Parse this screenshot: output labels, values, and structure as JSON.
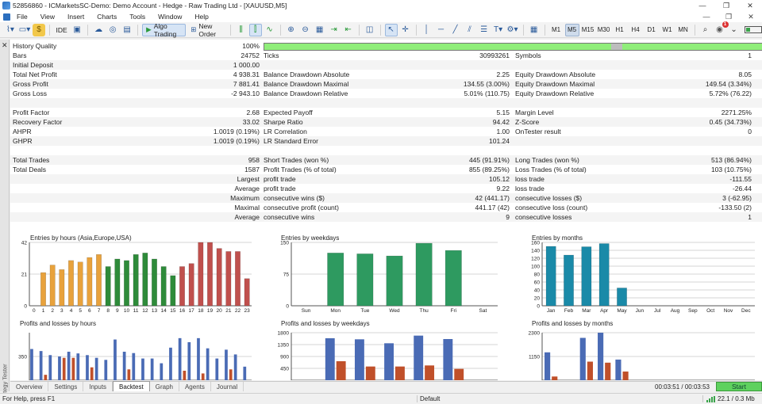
{
  "window": {
    "title": "52856860 - ICMarketsSC-Demo: Demo Account - Hedge - Raw Trading Ltd - [XAUUSD,M5]"
  },
  "menu": [
    "File",
    "View",
    "Insert",
    "Charts",
    "Tools",
    "Window",
    "Help"
  ],
  "toolbar": {
    "ide_label": "IDE",
    "algo_label": "Algo Trading",
    "neworder_label": "New Order",
    "timeframes": [
      "M1",
      "M5",
      "M15",
      "M30",
      "H1",
      "H4",
      "D1",
      "W1",
      "MN"
    ],
    "active_timeframe": "M5",
    "notifications": "1"
  },
  "side_panel": {
    "label": "Strategy Tester"
  },
  "report": {
    "history_quality": {
      "label": "History Quality",
      "value": "100%"
    },
    "rows": [
      {
        "l1": "Bars",
        "v1": "24752",
        "l2": "Ticks",
        "v2": "30993261",
        "l3": "Symbols",
        "v3": "1",
        "alt": false
      },
      {
        "l1": "Initial Deposit",
        "v1": "1 000.00",
        "l2": "",
        "v2": "",
        "l3": "",
        "v3": "",
        "alt": true
      },
      {
        "l1": "Total Net Profit",
        "v1": "4 938.31",
        "l2": "Balance Drawdown Absolute",
        "v2": "2.25",
        "l3": "Equity Drawdown Absolute",
        "v3": "8.05",
        "alt": false
      },
      {
        "l1": "Gross Profit",
        "v1": "7 881.41",
        "l2": "Balance Drawdown Maximal",
        "v2": "134.55 (3.00%)",
        "l3": "Equity Drawdown Maximal",
        "v3": "149.54 (3.34%)",
        "alt": true
      },
      {
        "l1": "Gross Loss",
        "v1": "-2 943.10",
        "l2": "Balance Drawdown Relative",
        "v2": "5.01% (110.75)",
        "l3": "Equity Drawdown Relative",
        "v3": "5.72% (76.22)",
        "alt": false
      },
      {
        "l1": "",
        "v1": "",
        "l2": "",
        "v2": "",
        "l3": "",
        "v3": "",
        "alt": true
      },
      {
        "l1": "Profit Factor",
        "v1": "2.68",
        "l2": "Expected Payoff",
        "v2": "5.15",
        "l3": "Margin Level",
        "v3": "2271.25%",
        "alt": false
      },
      {
        "l1": "Recovery Factor",
        "v1": "33.02",
        "l2": "Sharpe Ratio",
        "v2": "94.42",
        "l3": "Z-Score",
        "v3": "0.45 (34.73%)",
        "alt": true
      },
      {
        "l1": "AHPR",
        "v1": "1.0019 (0.19%)",
        "l2": "LR Correlation",
        "v2": "1.00",
        "l3": "OnTester result",
        "v3": "0",
        "alt": false
      },
      {
        "l1": "GHPR",
        "v1": "1.0019 (0.19%)",
        "l2": "LR Standard Error",
        "v2": "101.24",
        "l3": "",
        "v3": "",
        "alt": true
      },
      {
        "l1": "",
        "v1": "",
        "l2": "",
        "v2": "",
        "l3": "",
        "v3": "",
        "alt": false
      },
      {
        "l1": "Total Trades",
        "v1": "958",
        "l2": "Short Trades (won %)",
        "v2": "445 (91.91%)",
        "l3": "Long Trades (won %)",
        "v3": "513 (86.94%)",
        "alt": true
      },
      {
        "l1": "Total Deals",
        "v1": "1587",
        "l2": "Profit Trades (% of total)",
        "v2": "855 (89.25%)",
        "l3": "Loss Trades (% of total)",
        "v3": "103 (10.75%)",
        "alt": false
      },
      {
        "l1": "",
        "v1": "Largest",
        "l2": "profit trade",
        "v2": "105.12",
        "l3": "loss trade",
        "v3": "-111.55",
        "alt": true
      },
      {
        "l1": "",
        "v1": "Average",
        "l2": "profit trade",
        "v2": "9.22",
        "l3": "loss trade",
        "v3": "-26.44",
        "alt": false
      },
      {
        "l1": "",
        "v1": "Maximum",
        "l2": "consecutive wins ($)",
        "v2": "42 (441.17)",
        "l3": "consecutive losses ($)",
        "v3": "3 (-62.95)",
        "alt": true
      },
      {
        "l1": "",
        "v1": "Maximal",
        "l2": "consecutive profit (count)",
        "v2": "441.17 (42)",
        "l3": "consecutive loss (count)",
        "v3": "-133.50 (2)",
        "alt": false
      },
      {
        "l1": "",
        "v1": "Average",
        "l2": "consecutive wins",
        "v2": "9",
        "l3": "consecutive losses",
        "v3": "1",
        "alt": true
      }
    ]
  },
  "chart_data": [
    {
      "type": "bar",
      "title": "Entries by hours (Asia,Europe,USA)",
      "categories": [
        "0",
        "1",
        "2",
        "3",
        "4",
        "5",
        "6",
        "7",
        "8",
        "9",
        "10",
        "11",
        "12",
        "13",
        "14",
        "15",
        "16",
        "17",
        "18",
        "19",
        "20",
        "21",
        "22",
        "23"
      ],
      "values": [
        0,
        22,
        27,
        24,
        30,
        29,
        32,
        34,
        26,
        31,
        30,
        34,
        35,
        31,
        26,
        20,
        26,
        28,
        42,
        42,
        38,
        36,
        36,
        18
      ],
      "colors": [
        "#e8a23c",
        "#e8a23c",
        "#e8a23c",
        "#e8a23c",
        "#e8a23c",
        "#e8a23c",
        "#e8a23c",
        "#e8a23c",
        "#2e8b3a",
        "#2e8b3a",
        "#2e8b3a",
        "#2e8b3a",
        "#2e8b3a",
        "#2e8b3a",
        "#2e8b3a",
        "#2e8b3a",
        "#c0504d",
        "#c0504d",
        "#c0504d",
        "#c0504d",
        "#c0504d",
        "#c0504d",
        "#c0504d",
        "#c0504d"
      ],
      "yticks": [
        "0",
        "21",
        "42"
      ],
      "ylim": [
        0,
        42
      ]
    },
    {
      "type": "bar",
      "title": "Entries by weekdays",
      "categories": [
        "Sun",
        "Mon",
        "Tue",
        "Wed",
        "Thu",
        "Fri",
        "Sat"
      ],
      "values": [
        0,
        125,
        123,
        118,
        148,
        131,
        0
      ],
      "colors": [
        "#2e9a60",
        "#2e9a60",
        "#2e9a60",
        "#2e9a60",
        "#2e9a60",
        "#2e9a60",
        "#2e9a60"
      ],
      "yticks": [
        "0",
        "75",
        "150"
      ],
      "ylim": [
        0,
        150
      ]
    },
    {
      "type": "bar",
      "title": "Entries by months",
      "categories": [
        "Jan",
        "Feb",
        "Mar",
        "Apr",
        "May",
        "Jun",
        "Jul",
        "Aug",
        "Sep",
        "Oct",
        "Nov",
        "Dec"
      ],
      "values": [
        150,
        128,
        149,
        157,
        45,
        0,
        0,
        0,
        0,
        0,
        0,
        0
      ],
      "colors": [
        "#1a8aa8",
        "#1a8aa8",
        "#1a8aa8",
        "#1a8aa8",
        "#1a8aa8",
        "#1a8aa8",
        "#1a8aa8",
        "#1a8aa8",
        "#1a8aa8",
        "#1a8aa8",
        "#1a8aa8",
        "#1a8aa8"
      ],
      "yticks": [
        "0",
        "20",
        "40",
        "60",
        "80",
        "100",
        "120",
        "140",
        "160"
      ],
      "ylim": [
        0,
        160
      ]
    },
    {
      "type": "bar",
      "title": "Profits and losses by hours",
      "series": [
        {
          "values": [
            460,
            430,
            370,
            350,
            420,
            395,
            370,
            330,
            300,
            600,
            420,
            400,
            320,
            320,
            250,
            480,
            620,
            560,
            620,
            470,
            320,
            450,
            380,
            200
          ],
          "color": "#4a6bb5"
        },
        {
          "values": [
            0,
            80,
            0,
            330,
            330,
            0,
            190,
            0,
            0,
            0,
            160,
            0,
            0,
            0,
            0,
            0,
            140,
            0,
            100,
            0,
            0,
            160,
            0,
            0
          ],
          "color": "#c0502a"
        }
      ],
      "yticks": [
        "350"
      ],
      "ylim": [
        0,
        700
      ]
    },
    {
      "type": "bar",
      "title": "Profits and losses by weekdays",
      "series": [
        {
          "values": [
            0,
            1590,
            1550,
            1400,
            1690,
            1560,
            0
          ],
          "color": "#4a6bb5"
        },
        {
          "values": [
            0,
            720,
            520,
            520,
            560,
            430,
            0
          ],
          "color": "#c0502a"
        }
      ],
      "yticks": [
        "450",
        "900",
        "1350",
        "1800"
      ],
      "ylim": [
        0,
        1800
      ]
    },
    {
      "type": "bar",
      "title": "Profits and losses by months",
      "series": [
        {
          "values": [
            1350,
            0,
            2050,
            2300,
            1000,
            0,
            0,
            0,
            0,
            0,
            0,
            0
          ],
          "color": "#4a6bb5"
        },
        {
          "values": [
            180,
            0,
            900,
            850,
            420,
            0,
            0,
            0,
            0,
            0,
            0,
            0
          ],
          "color": "#c0502a"
        }
      ],
      "yticks": [
        "1150",
        "2300"
      ],
      "ylim": [
        0,
        2300
      ]
    }
  ],
  "tabs": [
    "Overview",
    "Settings",
    "Inputs",
    "Backtest",
    "Graph",
    "Agents",
    "Journal"
  ],
  "active_tab": "Backtest",
  "timer": "00:03:51 / 00:03:53",
  "start_label": "Start",
  "status": {
    "help": "For Help, press F1",
    "profile": "Default",
    "memory": "22.1 / 0.3 Mb"
  }
}
